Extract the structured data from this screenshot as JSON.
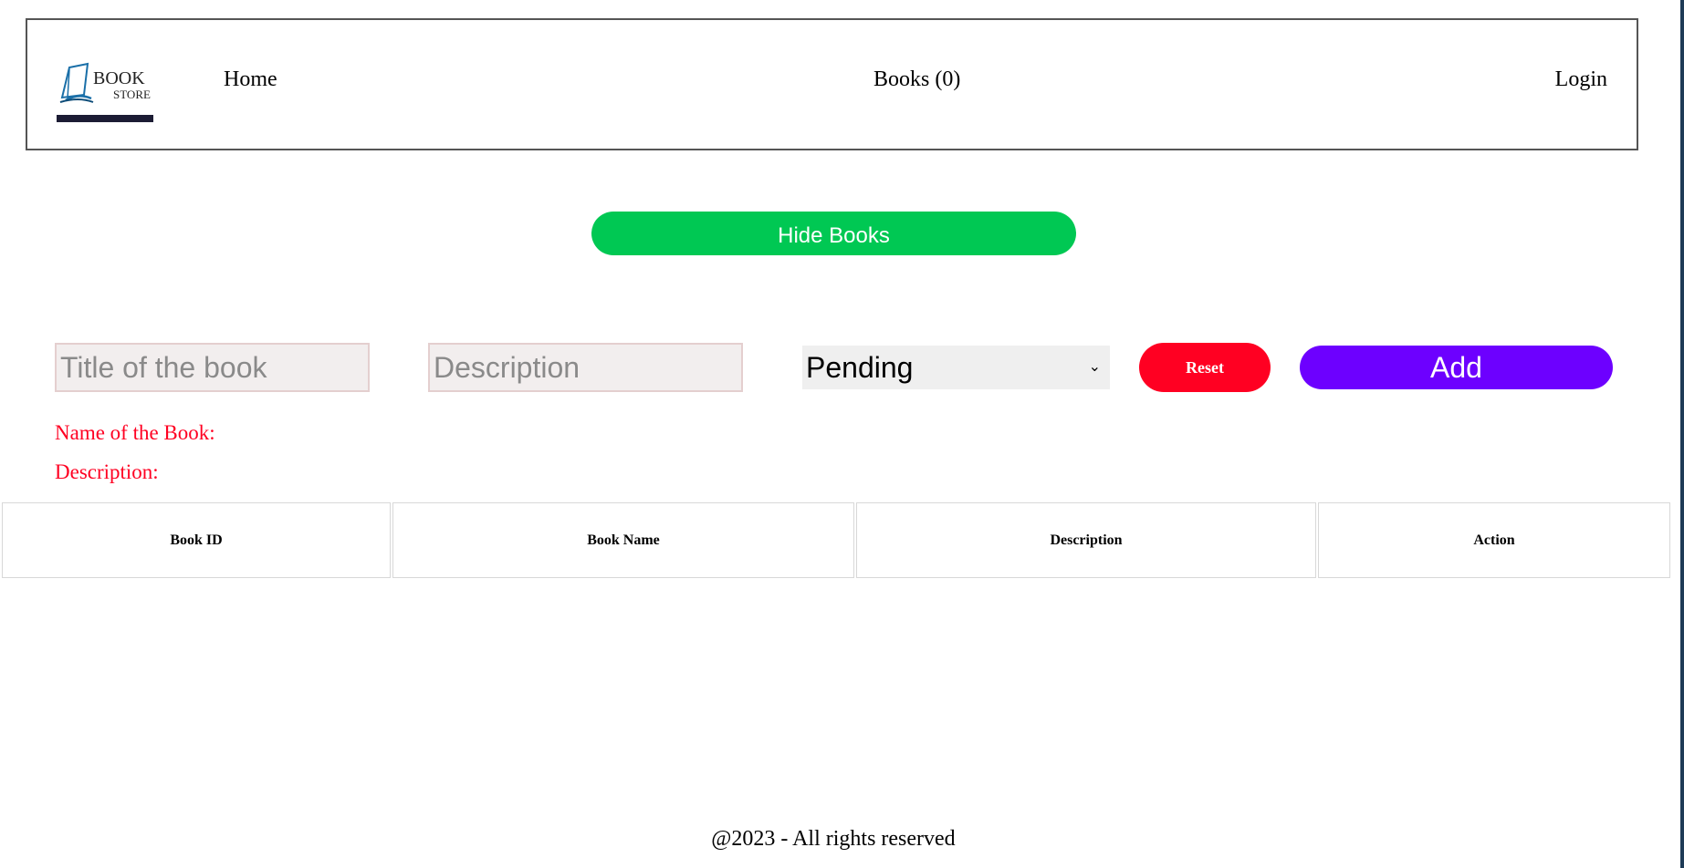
{
  "navbar": {
    "logo": {
      "text_line1": "BOOK",
      "text_line2": "STORE",
      "icon": "open-book-icon"
    },
    "links": {
      "home": "Home",
      "books": "Books (0)",
      "login": "Login"
    }
  },
  "toggle_button": {
    "label": "Hide Books",
    "color": "#00c853"
  },
  "form": {
    "title_placeholder": "Title of the book",
    "title_value": "",
    "description_placeholder": "Description",
    "description_value": "",
    "status_selected": "Pending",
    "reset_label": "Reset",
    "reset_color": "#ff0022",
    "add_label": "Add",
    "add_color": "#6d00ff"
  },
  "preview": {
    "name_label": "Name of the Book:",
    "description_label": "Description:",
    "color": "#ff0022"
  },
  "table": {
    "headers": [
      "Book ID",
      "Book Name",
      "Description",
      "Action"
    ],
    "rows": []
  },
  "footer": {
    "text": "@2023 - All rights reserved"
  }
}
